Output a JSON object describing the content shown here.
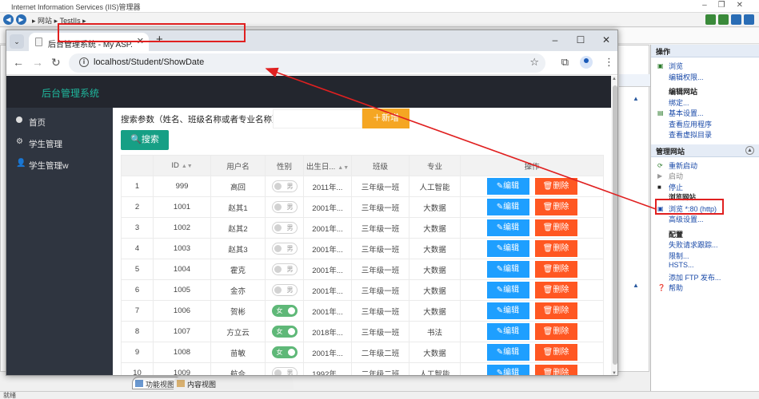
{
  "iis": {
    "title": "Internet Information Services (IIS)管理器",
    "breadcrumb_sep": "▸",
    "breadcrumb": [
      "网站",
      "TestIIs"
    ],
    "actions_header": "操作",
    "actions_browse": [
      "浏览",
      "编辑权限..."
    ],
    "actions_edit_site_header": "编辑网站",
    "actions_edit_site": [
      "绑定...",
      "基本设置...",
      "查看应用程序",
      "查看虚拟目录"
    ],
    "manage_site_header": "管理网站",
    "manage_site": [
      "重新启动",
      "启动",
      "停止"
    ],
    "browse_site_header": "浏览网站",
    "browse_link": "浏览 *:80 (http)",
    "advanced": "高级设置...",
    "config_header": "配置",
    "config": [
      "失败请求跟踪...",
      "限制...",
      "HSTS..."
    ],
    "ftp": "添加 FTP 发布...",
    "help": "帮助",
    "bottom_tabs": [
      "功能视图",
      "内容视图"
    ],
    "status": "就绪"
  },
  "chrome": {
    "tab_title": "后台管理系统 - My ASP.NET A",
    "url": "localhost/Student/ShowDate"
  },
  "app": {
    "logo": "后台管理系统",
    "menu": [
      {
        "label": "首页",
        "icon": "dot-icon"
      },
      {
        "label": "学生管理",
        "icon": "gear-icon"
      },
      {
        "label": "学生管理w",
        "icon": "user-icon"
      }
    ],
    "search_label": "搜索参数（姓名、班级名称或者专业名称）：",
    "search_value": "",
    "add_label": "＋新增",
    "search_button": "🔍搜索",
    "columns": [
      "ID",
      "用户名",
      "性别",
      "出生日...",
      "班级",
      "专业",
      "操作"
    ],
    "edit_label": "✎编辑",
    "delete_label": "🗑删除",
    "rows": [
      {
        "n": "1",
        "id": "999",
        "name": "高回",
        "gender": "男",
        "on": false,
        "birth": "2011年...",
        "cls": "三年级一班",
        "major": "人工智能"
      },
      {
        "n": "2",
        "id": "1001",
        "name": "赵其1",
        "gender": "男",
        "on": false,
        "birth": "2001年...",
        "cls": "三年级一班",
        "major": "大数据"
      },
      {
        "n": "3",
        "id": "1002",
        "name": "赵其2",
        "gender": "男",
        "on": false,
        "birth": "2001年...",
        "cls": "三年级一班",
        "major": "大数据"
      },
      {
        "n": "4",
        "id": "1003",
        "name": "赵其3",
        "gender": "男",
        "on": false,
        "birth": "2001年...",
        "cls": "三年级一班",
        "major": "大数据"
      },
      {
        "n": "5",
        "id": "1004",
        "name": "霍克",
        "gender": "男",
        "on": false,
        "birth": "2001年...",
        "cls": "三年级一班",
        "major": "大数据"
      },
      {
        "n": "6",
        "id": "1005",
        "name": "金亦",
        "gender": "男",
        "on": false,
        "birth": "2001年...",
        "cls": "三年级一班",
        "major": "大数据"
      },
      {
        "n": "7",
        "id": "1006",
        "name": "贺彬",
        "gender": "女",
        "on": true,
        "birth": "2001年...",
        "cls": "三年级一班",
        "major": "大数据"
      },
      {
        "n": "8",
        "id": "1007",
        "name": "方立云",
        "gender": "女",
        "on": true,
        "birth": "2018年...",
        "cls": "三年级一班",
        "major": "书法"
      },
      {
        "n": "9",
        "id": "1008",
        "name": "苗敏",
        "gender": "女",
        "on": true,
        "birth": "2001年...",
        "cls": "二年级二班",
        "major": "大数据"
      },
      {
        "n": "10",
        "id": "1009",
        "name": "航合",
        "gender": "男",
        "on": false,
        "birth": "1992年...",
        "cls": "二年级二班",
        "major": "人工智能"
      }
    ]
  },
  "colors": {
    "accent_red": "#e02020",
    "header": "#23262e",
    "sidebar": "#2f3540",
    "logo": "#1fb79d",
    "add": "#f5a623",
    "search": "#169f85",
    "edit": "#1e9fff",
    "delete": "#ff5722",
    "switch_on": "#5fb878"
  }
}
